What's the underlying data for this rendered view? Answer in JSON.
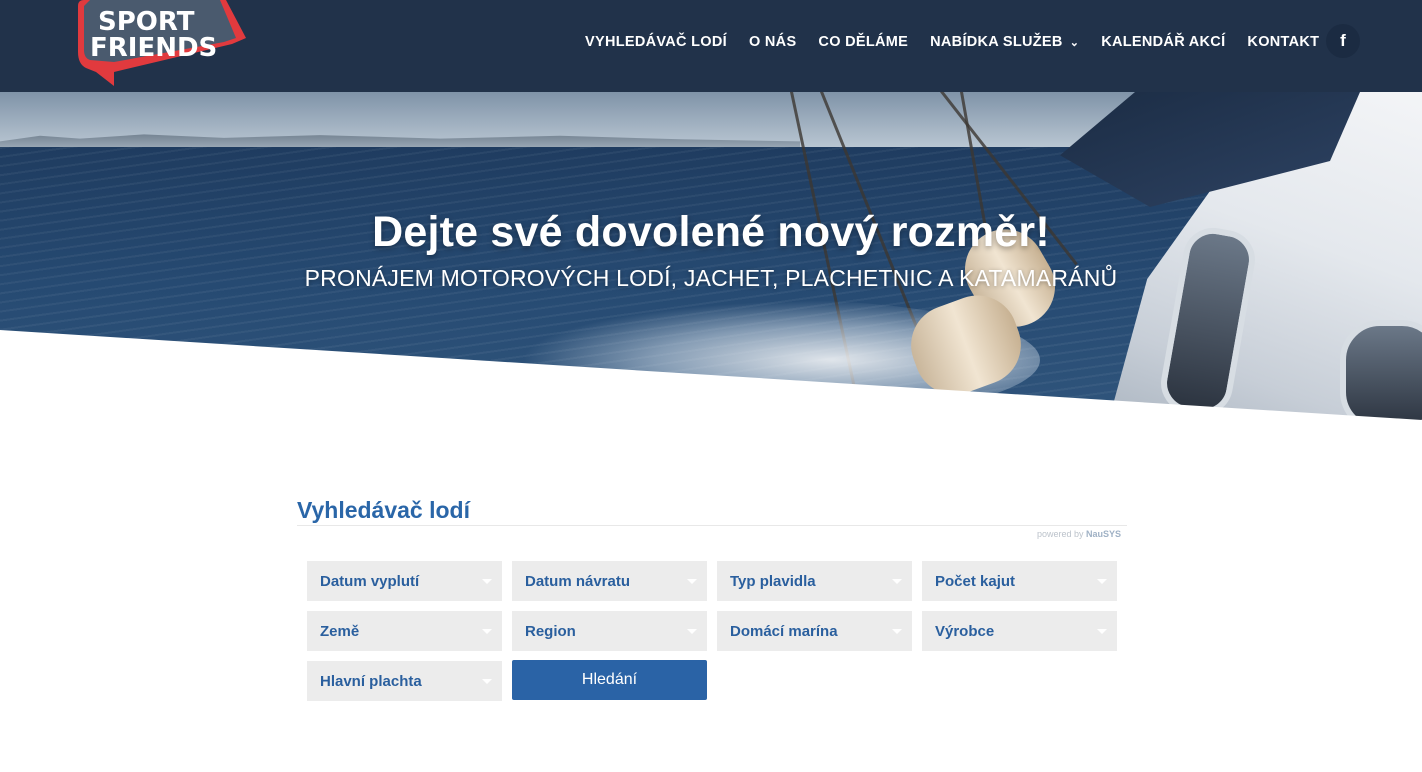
{
  "header": {
    "logo_line1": "SPORT",
    "logo_line2": "FRIENDS",
    "nav": [
      {
        "label": "VYHLEDÁVAČ LODÍ"
      },
      {
        "label": "O NÁS"
      },
      {
        "label": "CO DĚLÁME"
      },
      {
        "label": "NABÍDKA SLUŽEB",
        "has_dropdown": true
      },
      {
        "label": "KALENDÁŘ AKCÍ"
      },
      {
        "label": "KONTAKT"
      }
    ],
    "social": {
      "facebook_glyph": "f",
      "icon": "facebook-icon"
    }
  },
  "hero": {
    "title": "Dejte své dovolené nový rozměr!",
    "subtitle": "PRONÁJEM MOTOROVÝCH LODÍ, JACHET, PLACHETNIC A KATAMARÁNŮ"
  },
  "search": {
    "title": "Vyhledávač lodí",
    "powered_prefix": "powered by ",
    "powered_brand": "NauSYS",
    "fields": [
      "Datum vyplutí",
      "Datum návratu",
      "Typ plavidla",
      "Počet kajut",
      "Země",
      "Region",
      "Domácí marína",
      "Výrobce",
      "Hlavní plachta"
    ],
    "button_label": "Hledání"
  },
  "colors": {
    "nav_bg": "#22324a",
    "accent_blue": "#2a63a6",
    "field_bg": "#ececec",
    "field_text": "#2a5f9e",
    "logo_red": "#e13a3e"
  }
}
